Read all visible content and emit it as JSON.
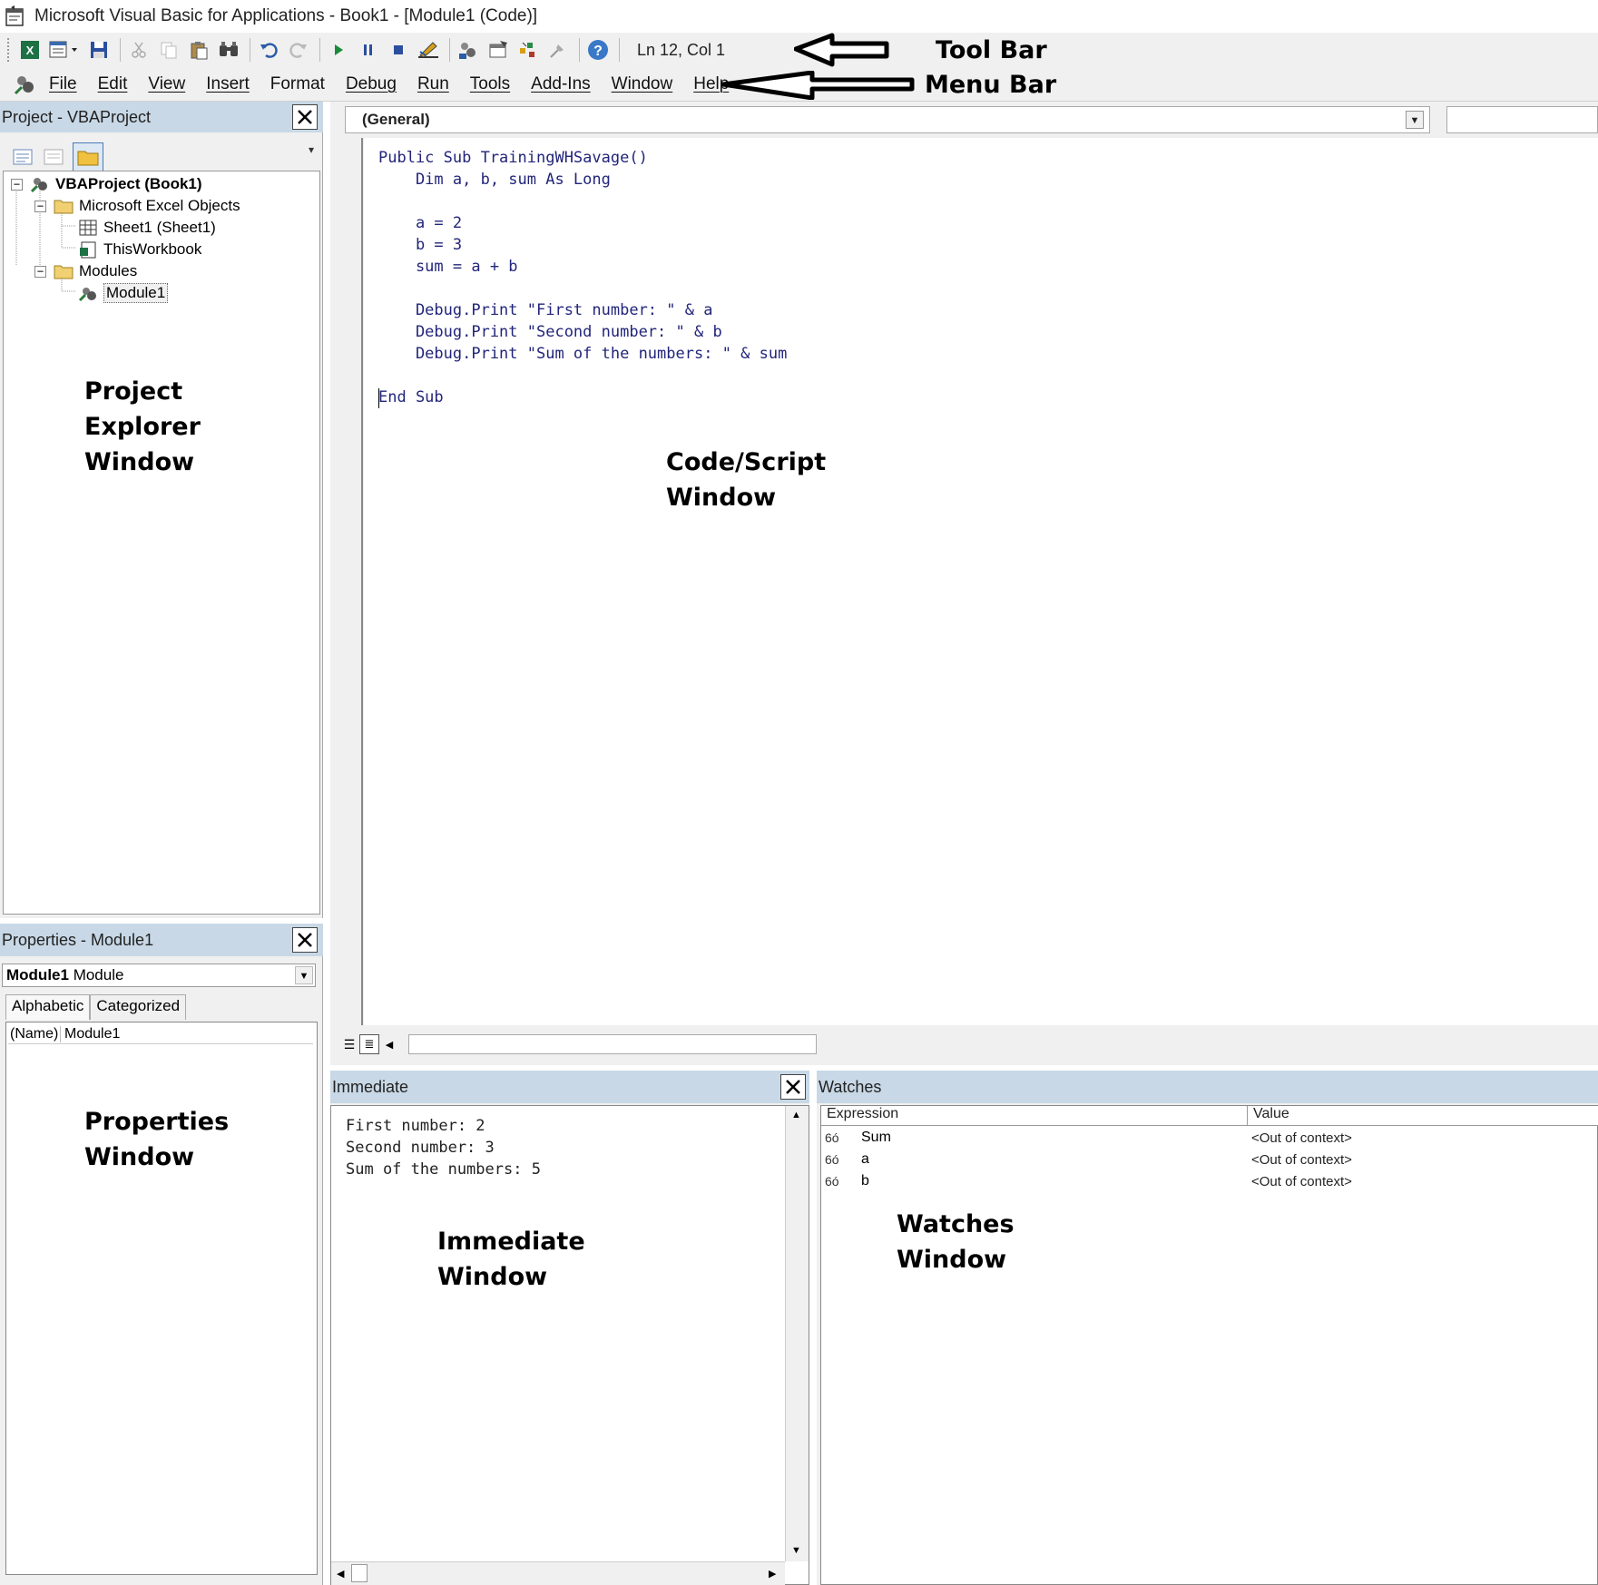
{
  "window": {
    "title": "Microsoft Visual Basic for Applications - Book1 - [Module1 (Code)]"
  },
  "toolbar": {
    "buttons": [
      "view-excel-icon",
      "insert-module-icon",
      "save-icon",
      "cut-icon",
      "copy-icon",
      "paste-icon",
      "find-icon",
      "undo-icon",
      "redo-icon",
      "run-icon",
      "break-icon",
      "reset-icon",
      "design-mode-icon",
      "project-explorer-icon",
      "properties-icon",
      "object-browser-icon",
      "toolbox-icon",
      "help-icon"
    ],
    "position": "Ln 12, Col 1"
  },
  "menu": {
    "items": [
      "File",
      "Edit",
      "View",
      "Insert",
      "Format",
      "Debug",
      "Run",
      "Tools",
      "Add-Ins",
      "Window",
      "Help"
    ]
  },
  "project": {
    "title": "Project - VBAProject",
    "root": "VBAProject (Book1)",
    "folder_objects": "Microsoft Excel Objects",
    "sheet1": "Sheet1 (Sheet1)",
    "workbook": "ThisWorkbook",
    "folder_modules": "Modules",
    "module1": "Module1"
  },
  "properties": {
    "title": "Properties - Module1",
    "object_name": "Module1",
    "object_type": "Module",
    "tab_alpha": "Alphabetic",
    "tab_cat": "Categorized",
    "prop_name": "(Name)",
    "prop_value": "Module1"
  },
  "code": {
    "object_combo": "(General)",
    "lines": [
      "Public Sub TrainingWHSavage()",
      "    Dim a, b, sum As Long",
      "",
      "    a = 2",
      "    b = 3",
      "    sum = a + b",
      "",
      "    Debug.Print \"First number: \" & a",
      "    Debug.Print \"Second number: \" & b",
      "    Debug.Print \"Sum of the numbers: \" & sum",
      "",
      "End Sub"
    ]
  },
  "immediate": {
    "title": "Immediate",
    "lines": [
      "First number: 2",
      "Second number: 3",
      "Sum of the numbers: 5"
    ]
  },
  "watches": {
    "title": "Watches",
    "col_expression": "Expression",
    "col_value": "Value",
    "rows": [
      {
        "expr": "Sum",
        "value": "<Out of context>"
      },
      {
        "expr": "a",
        "value": "<Out of context>"
      },
      {
        "expr": "b",
        "value": "<Out of context>"
      }
    ]
  },
  "annotations": {
    "toolbar": "Tool Bar",
    "menubar": "Menu Bar",
    "project_1": "Project",
    "project_2": "Explorer",
    "project_3": "Window",
    "code_1": "Code/Script",
    "code_2": "Window",
    "props_1": "Properties",
    "props_2": "Window",
    "imm_1": "Immediate",
    "imm_2": "Window",
    "watch_1": "Watches",
    "watch_2": "Window"
  }
}
